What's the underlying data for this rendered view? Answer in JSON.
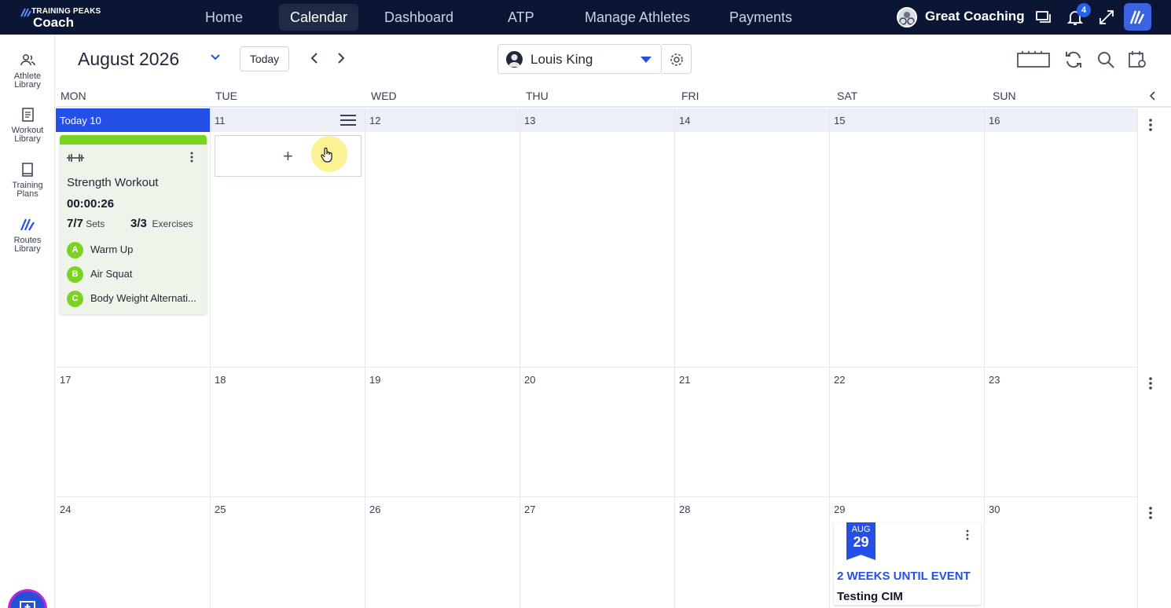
{
  "app": {
    "brand": "TRAINING PEAKS",
    "product": "Coach"
  },
  "nav": [
    {
      "label": "Home",
      "active": false
    },
    {
      "label": "Calendar",
      "active": true
    },
    {
      "label": "Dashboard",
      "active": false
    },
    {
      "label": "ATP",
      "active": false
    },
    {
      "label": "Manage Athletes",
      "active": false
    },
    {
      "label": "Payments",
      "active": false
    }
  ],
  "account": {
    "name": "Great Coaching",
    "notification_count": "4"
  },
  "sidebar": [
    {
      "label_1": "Athlete",
      "label_2": "Library",
      "icon": "athletes-icon"
    },
    {
      "label_1": "Workout",
      "label_2": "Library",
      "icon": "workout-library-icon"
    },
    {
      "label_1": "Training",
      "label_2": "Plans",
      "icon": "training-plans-icon"
    },
    {
      "label_1": "Routes",
      "label_2": "Library",
      "icon": "routes-icon"
    }
  ],
  "calendar": {
    "month_label": "August 2026",
    "today_label": "Today",
    "athlete": "Louis King",
    "weekdays": [
      "MON",
      "TUE",
      "WED",
      "THU",
      "FRI",
      "SAT",
      "SUN"
    ],
    "weeks": [
      [
        "Today 10",
        "11",
        "12",
        "13",
        "14",
        "15",
        "16"
      ],
      [
        "17",
        "18",
        "19",
        "20",
        "21",
        "22",
        "23"
      ],
      [
        "24",
        "25",
        "26",
        "27",
        "28",
        "29",
        "30"
      ]
    ]
  },
  "workout": {
    "title": "Strength Workout",
    "duration": "00:00:26",
    "sets_value": "7/7",
    "sets_label": "Sets",
    "exercises_value": "3/3",
    "exercises_label": "Exercises",
    "exercises": [
      {
        "letter": "A",
        "name": "Warm Up"
      },
      {
        "letter": "B",
        "name": "Air Squat"
      },
      {
        "letter": "C",
        "name": "Body Weight Alternati..."
      }
    ],
    "accent_color": "#7bd321"
  },
  "add_workout": {
    "symbol": "+"
  },
  "event": {
    "month": "AUG",
    "day": "29",
    "countdown": "2 WEEKS UNTIL EVENT",
    "name": "Testing CIM"
  },
  "colors": {
    "nav_bg": "#0a1633",
    "primary": "#2450e8",
    "today_strip": "#eceff7"
  }
}
